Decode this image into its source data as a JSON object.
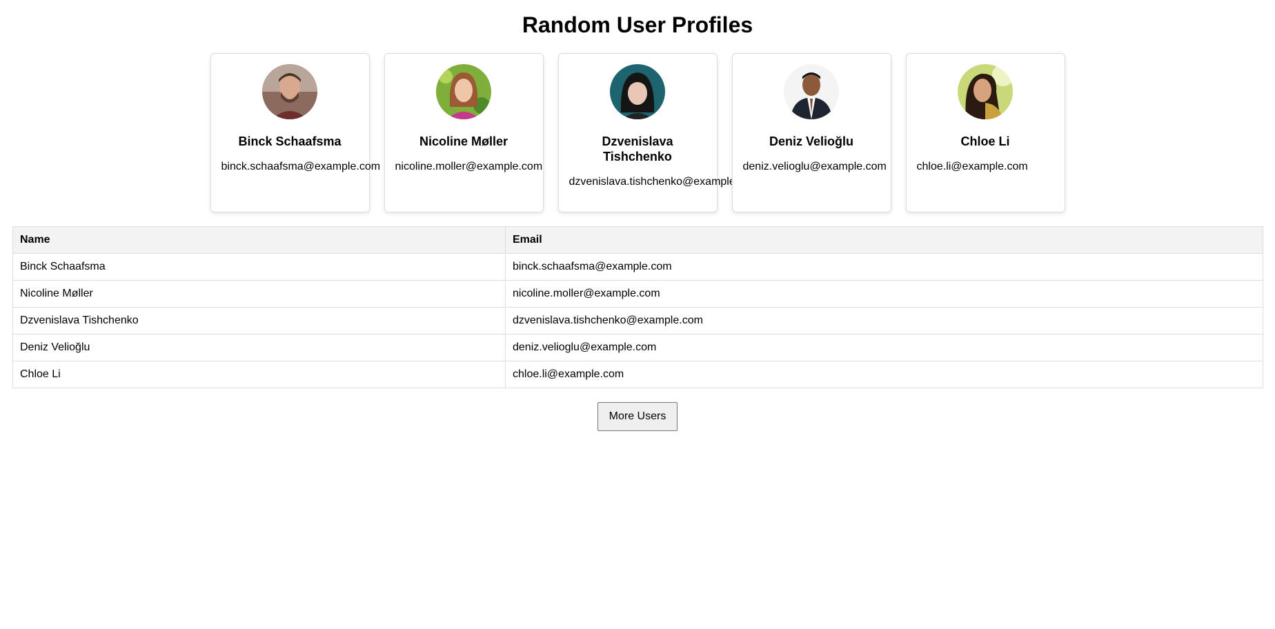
{
  "page": {
    "title": "Random User Profiles"
  },
  "users": [
    {
      "name": "Binck Schaafsma",
      "email": "binck.schaafsma@example.com"
    },
    {
      "name": "Nicoline Møller",
      "email": "nicoline.moller@example.com"
    },
    {
      "name": "Dzvenislava Tishchenko",
      "email": "dzvenislava.tishchenko@example.com"
    },
    {
      "name": "Deniz Velioğlu",
      "email": "deniz.velioglu@example.com"
    },
    {
      "name": "Chloe Li",
      "email": "chloe.li@example.com"
    }
  ],
  "table": {
    "headers": {
      "name": "Name",
      "email": "Email"
    }
  },
  "actions": {
    "more_users_label": "More Users"
  },
  "colors": {
    "card_border": "#dcdcdc",
    "table_header_bg": "#f3f3f3",
    "table_border": "#dddddd",
    "button_bg": "#efefef"
  }
}
